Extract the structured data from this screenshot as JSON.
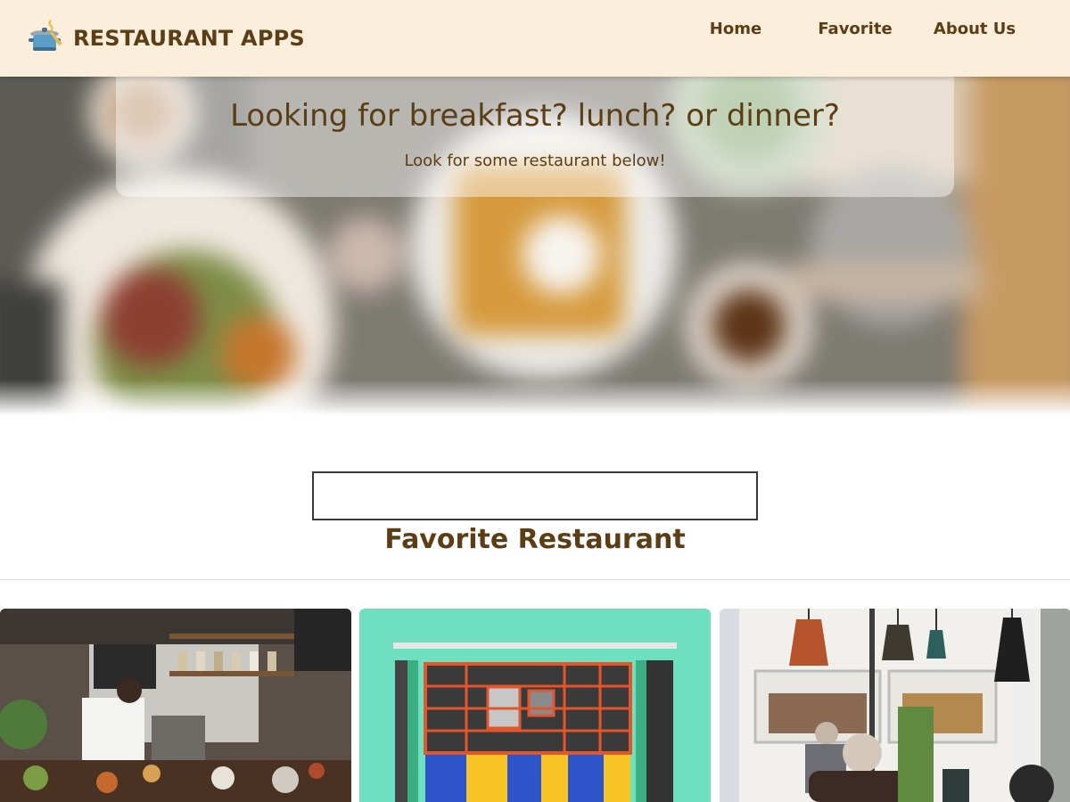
{
  "header": {
    "title": "RESTAURANT APPS",
    "logo_icon": "cooking-pot-icon",
    "nav": [
      "Home",
      "Favorite",
      "About Us"
    ]
  },
  "hero": {
    "title": "Looking for breakfast? lunch? or dinner?",
    "subtitle": "Look for some restaurant below!"
  },
  "search": {
    "value": "",
    "placeholder": ""
  },
  "favorites": {
    "title": "Favorite Restaurant",
    "cards": [
      "cafe-kitchen-photo",
      "colorful-storefront-photo",
      "cafe-window-lamps-photo"
    ]
  },
  "colors": {
    "header_bg": "#fbeedb",
    "brand_text": "#5b3e15",
    "accent_mint": "#6fe0bf"
  }
}
